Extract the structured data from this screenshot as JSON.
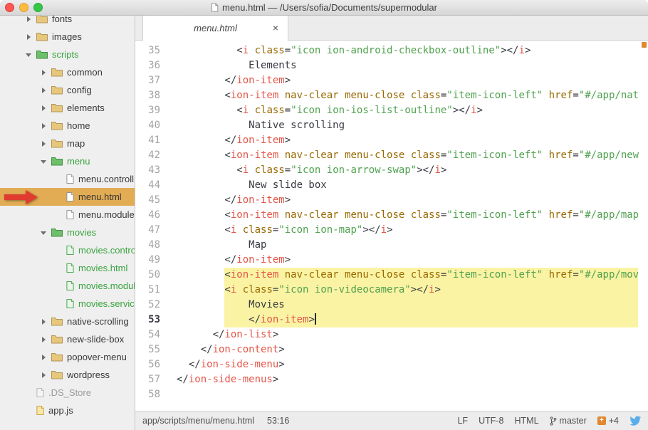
{
  "colors": {
    "hl-yellow": "#FAF3A3",
    "selected-row": "#E2AC54",
    "git-green": "#38A33E",
    "arrow-red": "#E03B2F",
    "bird-blue": "#59ADEB",
    "tag-red": "#E45649",
    "attr-gold": "#986801",
    "string-green": "#50A14F",
    "code-text": "#383A42",
    "diff-orange": "#E1872F"
  },
  "window": {
    "title": "menu.html — /Users/sofia/Documents/supermodular",
    "title_icon": "document-icon",
    "traffic_lights": [
      "close",
      "minimize",
      "zoom"
    ]
  },
  "tab": {
    "title": "menu.html",
    "close": "×"
  },
  "sidebar": {
    "items": [
      {
        "label": "fonts",
        "level": 0,
        "kind": "folder-closed"
      },
      {
        "label": "images",
        "level": 0,
        "kind": "folder-closed"
      },
      {
        "label": "scripts",
        "level": 0,
        "kind": "folder-open",
        "status": "green"
      },
      {
        "label": "common",
        "level": 1,
        "kind": "folder-closed"
      },
      {
        "label": "config",
        "level": 1,
        "kind": "folder-closed"
      },
      {
        "label": "elements",
        "level": 1,
        "kind": "folder-closed"
      },
      {
        "label": "home",
        "level": 1,
        "kind": "folder-closed"
      },
      {
        "label": "map",
        "level": 1,
        "kind": "folder-closed"
      },
      {
        "label": "menu",
        "level": 1,
        "kind": "folder-open",
        "status": "green"
      },
      {
        "label": "menu.controll",
        "level": 2,
        "kind": "file"
      },
      {
        "label": "menu.html",
        "level": 2,
        "kind": "file",
        "selected": true,
        "arrow": true
      },
      {
        "label": "menu.module",
        "level": 2,
        "kind": "file"
      },
      {
        "label": "movies",
        "level": 1,
        "kind": "folder-open",
        "status": "green"
      },
      {
        "label": "movies.contro",
        "level": 2,
        "kind": "file",
        "status": "green"
      },
      {
        "label": "movies.html",
        "level": 2,
        "kind": "file",
        "status": "green"
      },
      {
        "label": "movies.modul",
        "level": 2,
        "kind": "file",
        "status": "green"
      },
      {
        "label": "movies.servic",
        "level": 2,
        "kind": "file",
        "status": "green"
      },
      {
        "label": "native-scrolling",
        "level": 1,
        "kind": "folder-closed"
      },
      {
        "label": "new-slide-box",
        "level": 1,
        "kind": "folder-closed"
      },
      {
        "label": "popover-menu",
        "level": 1,
        "kind": "folder-closed"
      },
      {
        "label": "wordpress",
        "level": 1,
        "kind": "folder-closed"
      },
      {
        "label": ".DS_Store",
        "level": 0,
        "kind": "file",
        "status": "ignored"
      },
      {
        "label": "app.js",
        "level": 0,
        "kind": "file",
        "status": "js"
      }
    ]
  },
  "code": {
    "token_classes": {
      "p": "punctuation",
      "t": "tag",
      "a": "attribute",
      "s": "string",
      "x": "text"
    },
    "lines": [
      {
        "n": 35,
        "ind": 10,
        "seg": [
          [
            "p",
            "<"
          ],
          [
            "t",
            "i"
          ],
          [
            "p",
            " "
          ],
          [
            "a",
            "class"
          ],
          [
            "p",
            "="
          ],
          [
            "s",
            "\"icon ion-android-checkbox-outline\""
          ],
          [
            "p",
            "></"
          ],
          [
            "t",
            "i"
          ],
          [
            "p",
            ">"
          ]
        ]
      },
      {
        "n": 36,
        "ind": 12,
        "seg": [
          [
            "x",
            "Elements"
          ]
        ]
      },
      {
        "n": 37,
        "ind": 8,
        "seg": [
          [
            "p",
            "</"
          ],
          [
            "t",
            "ion-item"
          ],
          [
            "p",
            ">"
          ]
        ]
      },
      {
        "n": 38,
        "ind": 8,
        "seg": [
          [
            "p",
            "<"
          ],
          [
            "t",
            "ion-item"
          ],
          [
            "p",
            " "
          ],
          [
            "a",
            "nav-clear"
          ],
          [
            "p",
            " "
          ],
          [
            "a",
            "menu-close"
          ],
          [
            "p",
            " "
          ],
          [
            "a",
            "class"
          ],
          [
            "p",
            "="
          ],
          [
            "s",
            "\"item-icon-left\""
          ],
          [
            "p",
            " "
          ],
          [
            "a",
            "href"
          ],
          [
            "p",
            "="
          ],
          [
            "s",
            "\"#/app/nat"
          ]
        ]
      },
      {
        "n": 39,
        "ind": 10,
        "seg": [
          [
            "p",
            "<"
          ],
          [
            "t",
            "i"
          ],
          [
            "p",
            " "
          ],
          [
            "a",
            "class"
          ],
          [
            "p",
            "="
          ],
          [
            "s",
            "\"icon ion-ios-list-outline\""
          ],
          [
            "p",
            "></"
          ],
          [
            "t",
            "i"
          ],
          [
            "p",
            ">"
          ]
        ]
      },
      {
        "n": 40,
        "ind": 12,
        "seg": [
          [
            "x",
            "Native scrolling"
          ]
        ]
      },
      {
        "n": 41,
        "ind": 8,
        "seg": [
          [
            "p",
            "</"
          ],
          [
            "t",
            "ion-item"
          ],
          [
            "p",
            ">"
          ]
        ]
      },
      {
        "n": 42,
        "ind": 8,
        "seg": [
          [
            "p",
            "<"
          ],
          [
            "t",
            "ion-item"
          ],
          [
            "p",
            " "
          ],
          [
            "a",
            "nav-clear"
          ],
          [
            "p",
            " "
          ],
          [
            "a",
            "menu-close"
          ],
          [
            "p",
            " "
          ],
          [
            "a",
            "class"
          ],
          [
            "p",
            "="
          ],
          [
            "s",
            "\"item-icon-left\""
          ],
          [
            "p",
            " "
          ],
          [
            "a",
            "href"
          ],
          [
            "p",
            "="
          ],
          [
            "s",
            "\"#/app/new"
          ]
        ]
      },
      {
        "n": 43,
        "ind": 10,
        "seg": [
          [
            "p",
            "<"
          ],
          [
            "t",
            "i"
          ],
          [
            "p",
            " "
          ],
          [
            "a",
            "class"
          ],
          [
            "p",
            "="
          ],
          [
            "s",
            "\"icon ion-arrow-swap\""
          ],
          [
            "p",
            "></"
          ],
          [
            "t",
            "i"
          ],
          [
            "p",
            ">"
          ]
        ]
      },
      {
        "n": 44,
        "ind": 12,
        "seg": [
          [
            "x",
            "New slide box"
          ]
        ]
      },
      {
        "n": 45,
        "ind": 8,
        "seg": [
          [
            "p",
            "</"
          ],
          [
            "t",
            "ion-item"
          ],
          [
            "p",
            ">"
          ]
        ]
      },
      {
        "n": 46,
        "ind": 8,
        "seg": [
          [
            "p",
            "<"
          ],
          [
            "t",
            "ion-item"
          ],
          [
            "p",
            " "
          ],
          [
            "a",
            "nav-clear"
          ],
          [
            "p",
            " "
          ],
          [
            "a",
            "menu-close"
          ],
          [
            "p",
            " "
          ],
          [
            "a",
            "class"
          ],
          [
            "p",
            "="
          ],
          [
            "s",
            "\"item-icon-left\""
          ],
          [
            "p",
            " "
          ],
          [
            "a",
            "href"
          ],
          [
            "p",
            "="
          ],
          [
            "s",
            "\"#/app/map"
          ]
        ]
      },
      {
        "n": 47,
        "ind": 8,
        "seg": [
          [
            "p",
            "<"
          ],
          [
            "t",
            "i"
          ],
          [
            "p",
            " "
          ],
          [
            "a",
            "class"
          ],
          [
            "p",
            "="
          ],
          [
            "s",
            "\"icon ion-map\""
          ],
          [
            "p",
            "></"
          ],
          [
            "t",
            "i"
          ],
          [
            "p",
            ">"
          ]
        ]
      },
      {
        "n": 48,
        "ind": 12,
        "seg": [
          [
            "x",
            "Map"
          ]
        ]
      },
      {
        "n": 49,
        "ind": 8,
        "seg": [
          [
            "p",
            "</"
          ],
          [
            "t",
            "ion-item"
          ],
          [
            "p",
            ">"
          ]
        ]
      },
      {
        "n": 50,
        "ind": 8,
        "hl": true,
        "seg": [
          [
            "p",
            "<"
          ],
          [
            "t",
            "ion-item"
          ],
          [
            "p",
            " "
          ],
          [
            "a",
            "nav-clear"
          ],
          [
            "p",
            " "
          ],
          [
            "a",
            "menu-close"
          ],
          [
            "p",
            " "
          ],
          [
            "a",
            "class"
          ],
          [
            "p",
            "="
          ],
          [
            "s",
            "\"item-icon-left\""
          ],
          [
            "p",
            " "
          ],
          [
            "a",
            "href"
          ],
          [
            "p",
            "="
          ],
          [
            "s",
            "\"#/app/mov"
          ]
        ]
      },
      {
        "n": 51,
        "ind": 8,
        "hl": true,
        "seg": [
          [
            "p",
            "<"
          ],
          [
            "t",
            "i"
          ],
          [
            "p",
            " "
          ],
          [
            "a",
            "class"
          ],
          [
            "p",
            "="
          ],
          [
            "s",
            "\"icon ion-videocamera\""
          ],
          [
            "p",
            "></"
          ],
          [
            "t",
            "i"
          ],
          [
            "p",
            ">"
          ]
        ]
      },
      {
        "n": 52,
        "ind": 12,
        "hl": true,
        "seg": [
          [
            "x",
            "Movies"
          ]
        ]
      },
      {
        "n": 53,
        "ind": 12,
        "hl": true,
        "cursor": true,
        "active": true,
        "seg": [
          [
            "p",
            "</"
          ],
          [
            "t",
            "ion-item"
          ],
          [
            "p",
            ">"
          ]
        ]
      },
      {
        "n": 54,
        "ind": 6,
        "seg": [
          [
            "p",
            "</"
          ],
          [
            "t",
            "ion-list"
          ],
          [
            "p",
            ">"
          ]
        ]
      },
      {
        "n": 55,
        "ind": 4,
        "seg": [
          [
            "p",
            "</"
          ],
          [
            "t",
            "ion-content"
          ],
          [
            "p",
            ">"
          ]
        ]
      },
      {
        "n": 56,
        "ind": 2,
        "seg": [
          [
            "p",
            "</"
          ],
          [
            "t",
            "ion-side-menu"
          ],
          [
            "p",
            ">"
          ]
        ]
      },
      {
        "n": 57,
        "ind": 0,
        "seg": [
          [
            "p",
            "</"
          ],
          [
            "t",
            "ion-side-menus"
          ],
          [
            "p",
            ">"
          ]
        ]
      },
      {
        "n": 58,
        "ind": 0,
        "seg": []
      }
    ]
  },
  "statusbar": {
    "path": "app/scripts/menu/menu.html",
    "position": "53:16",
    "line_ending": "LF",
    "encoding": "UTF-8",
    "grammar": "HTML",
    "branch": "master",
    "diff": "+4",
    "icons": [
      "branch-icon",
      "diff-plus-icon",
      "bird-icon"
    ]
  }
}
